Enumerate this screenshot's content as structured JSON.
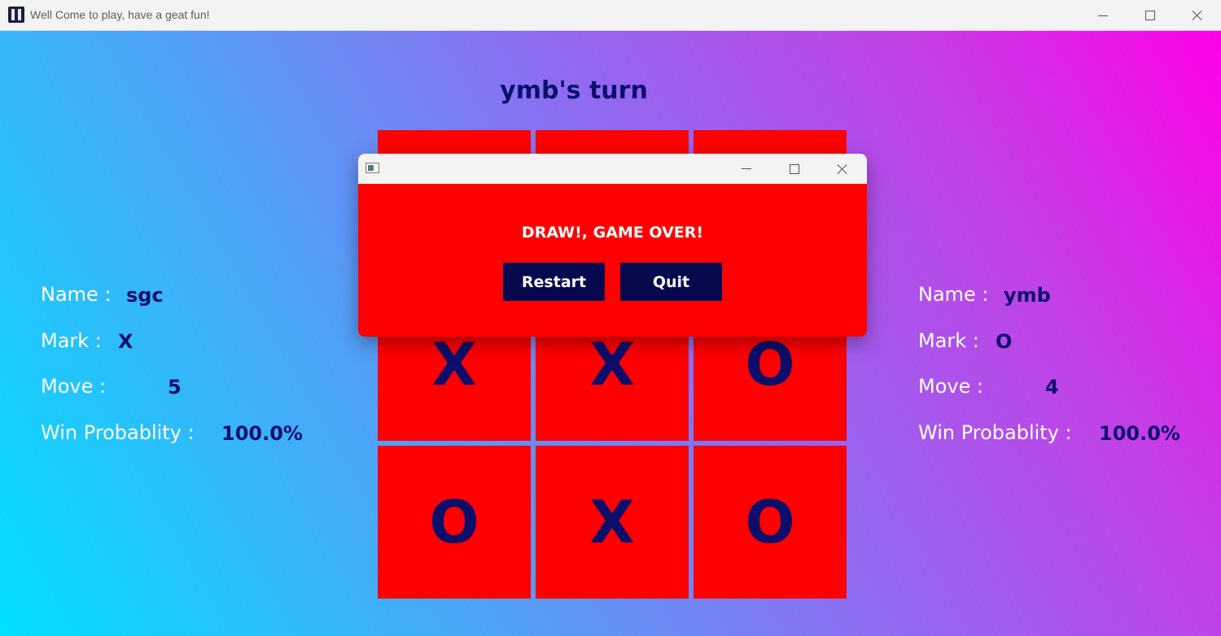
{
  "window": {
    "title": "Well Come to play, have a geat fun!",
    "icon": "app-icon"
  },
  "game": {
    "turn_text": "ymb's turn",
    "board": [
      [
        "",
        "",
        ""
      ],
      [
        "X",
        "X",
        "O"
      ],
      [
        "O",
        "X",
        "O"
      ]
    ]
  },
  "player1": {
    "name_label": "Name :",
    "name": "sgc",
    "mark_label": "Mark :",
    "mark": "X",
    "move_label": "Move :",
    "move": "5",
    "win_label": "Win Probablity :",
    "win": "100.0%"
  },
  "player2": {
    "name_label": "Name :",
    "name": "ymb",
    "mark_label": "Mark :",
    "mark": "O",
    "move_label": "Move :",
    "move": "4",
    "win_label": "Win Probablity :",
    "win": "100.0%"
  },
  "dialog": {
    "message": "DRAW!, GAME OVER!",
    "restart_label": "Restart",
    "quit_label": "Quit"
  },
  "colors": {
    "cell": "#ff0000",
    "mark": "#0c0e6a",
    "button": "#07084e"
  }
}
